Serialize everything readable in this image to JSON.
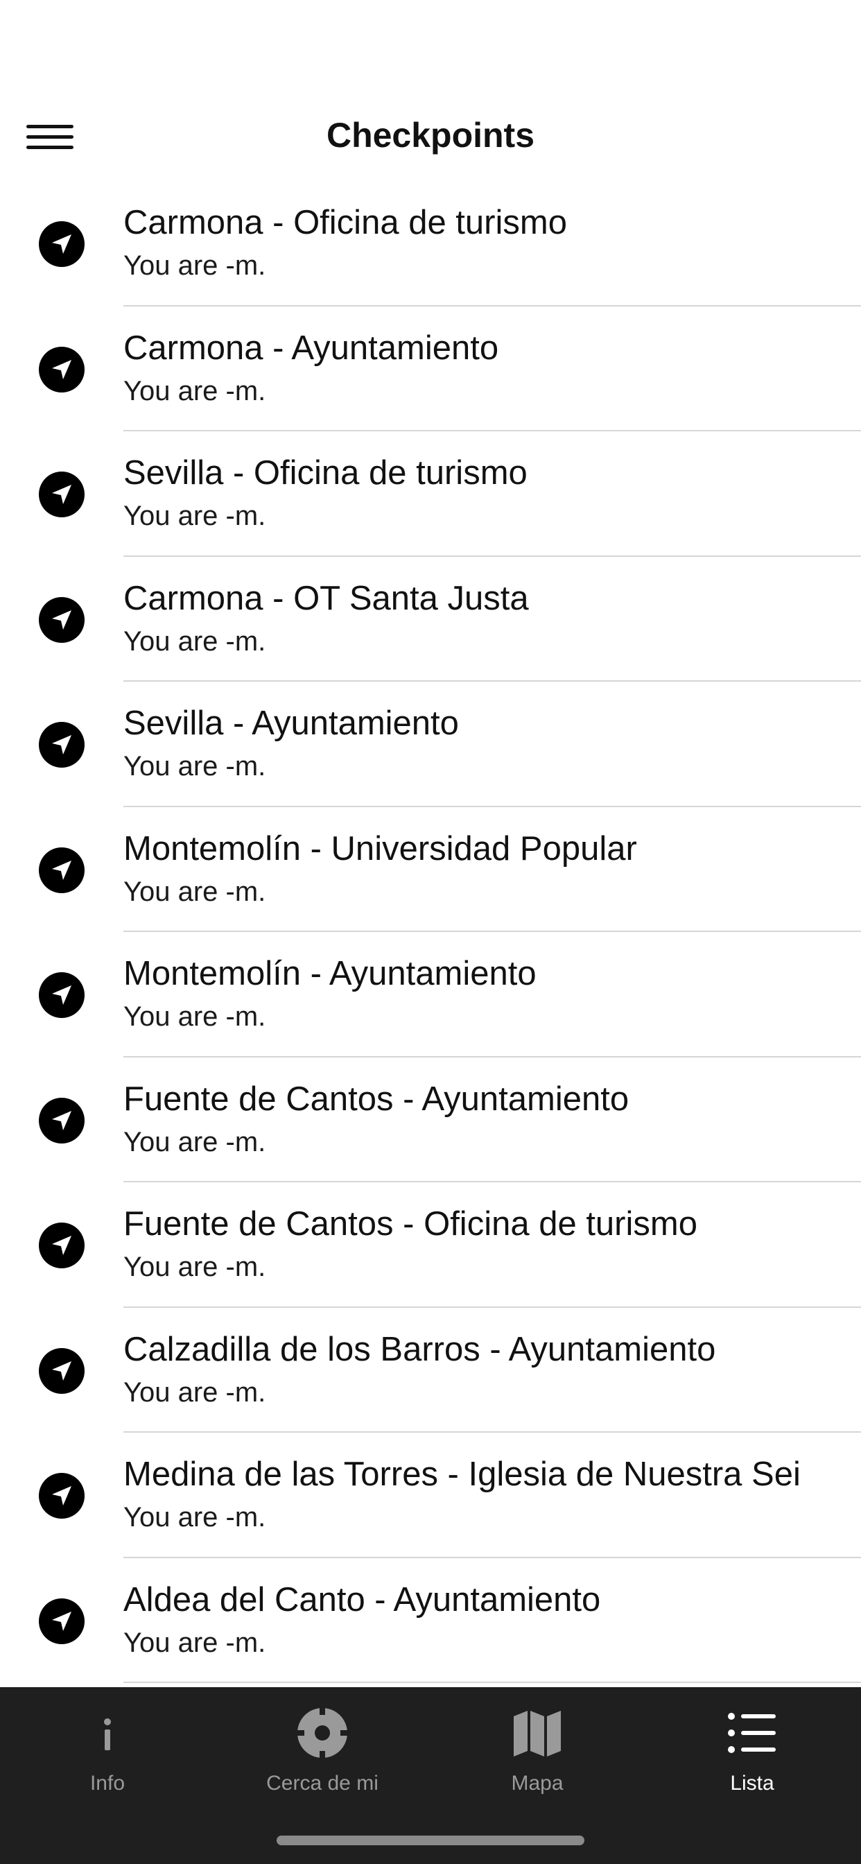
{
  "header": {
    "title": "Checkpoints",
    "menu_icon": "hamburger-menu-icon"
  },
  "checkpoints": [
    {
      "name": "Carmona - Oficina de turismo",
      "distance_text": "You are -m.",
      "icon": "navigation-arrow-icon"
    },
    {
      "name": "Carmona - Ayuntamiento",
      "distance_text": "You are -m.",
      "icon": "navigation-arrow-icon"
    },
    {
      "name": "Sevilla - Oficina de turismo",
      "distance_text": "You are -m.",
      "icon": "navigation-arrow-icon"
    },
    {
      "name": "Carmona - OT Santa Justa",
      "distance_text": "You are -m.",
      "icon": "navigation-arrow-icon"
    },
    {
      "name": "Sevilla - Ayuntamiento",
      "distance_text": "You are -m.",
      "icon": "navigation-arrow-icon"
    },
    {
      "name": "Montemolín - Universidad Popular",
      "distance_text": "You are -m.",
      "icon": "navigation-arrow-icon"
    },
    {
      "name": "Montemolín - Ayuntamiento",
      "distance_text": "You are -m.",
      "icon": "navigation-arrow-icon"
    },
    {
      "name": "Fuente de Cantos - Ayuntamiento",
      "distance_text": "You are -m.",
      "icon": "navigation-arrow-icon"
    },
    {
      "name": "Fuente de Cantos - Oficina de turismo",
      "distance_text": "You are -m.",
      "icon": "navigation-arrow-icon"
    },
    {
      "name": "Calzadilla de los Barros - Ayuntamiento",
      "distance_text": "You are -m.",
      "icon": "navigation-arrow-icon"
    },
    {
      "name": "Medina de las Torres - Iglesia de Nuestra Sei",
      "distance_text": "You are -m.",
      "icon": "navigation-arrow-icon"
    },
    {
      "name": "Aldea del Canto - Ayuntamiento",
      "distance_text": "You are -m.",
      "icon": "navigation-arrow-icon"
    }
  ],
  "tabs": [
    {
      "label": "Info",
      "icon": "info-icon",
      "active": false
    },
    {
      "label": "Cerca de mi",
      "icon": "locate-crosshair-icon",
      "active": false
    },
    {
      "label": "Mapa",
      "icon": "map-icon",
      "active": false
    },
    {
      "label": "Lista",
      "icon": "list-icon",
      "active": true
    }
  ],
  "colors": {
    "background": "#ffffff",
    "tab_bar": "#1f1f1f",
    "tab_inactive": "#9a9a9a",
    "tab_active": "#ffffff",
    "separator": "#d6d6d6"
  }
}
